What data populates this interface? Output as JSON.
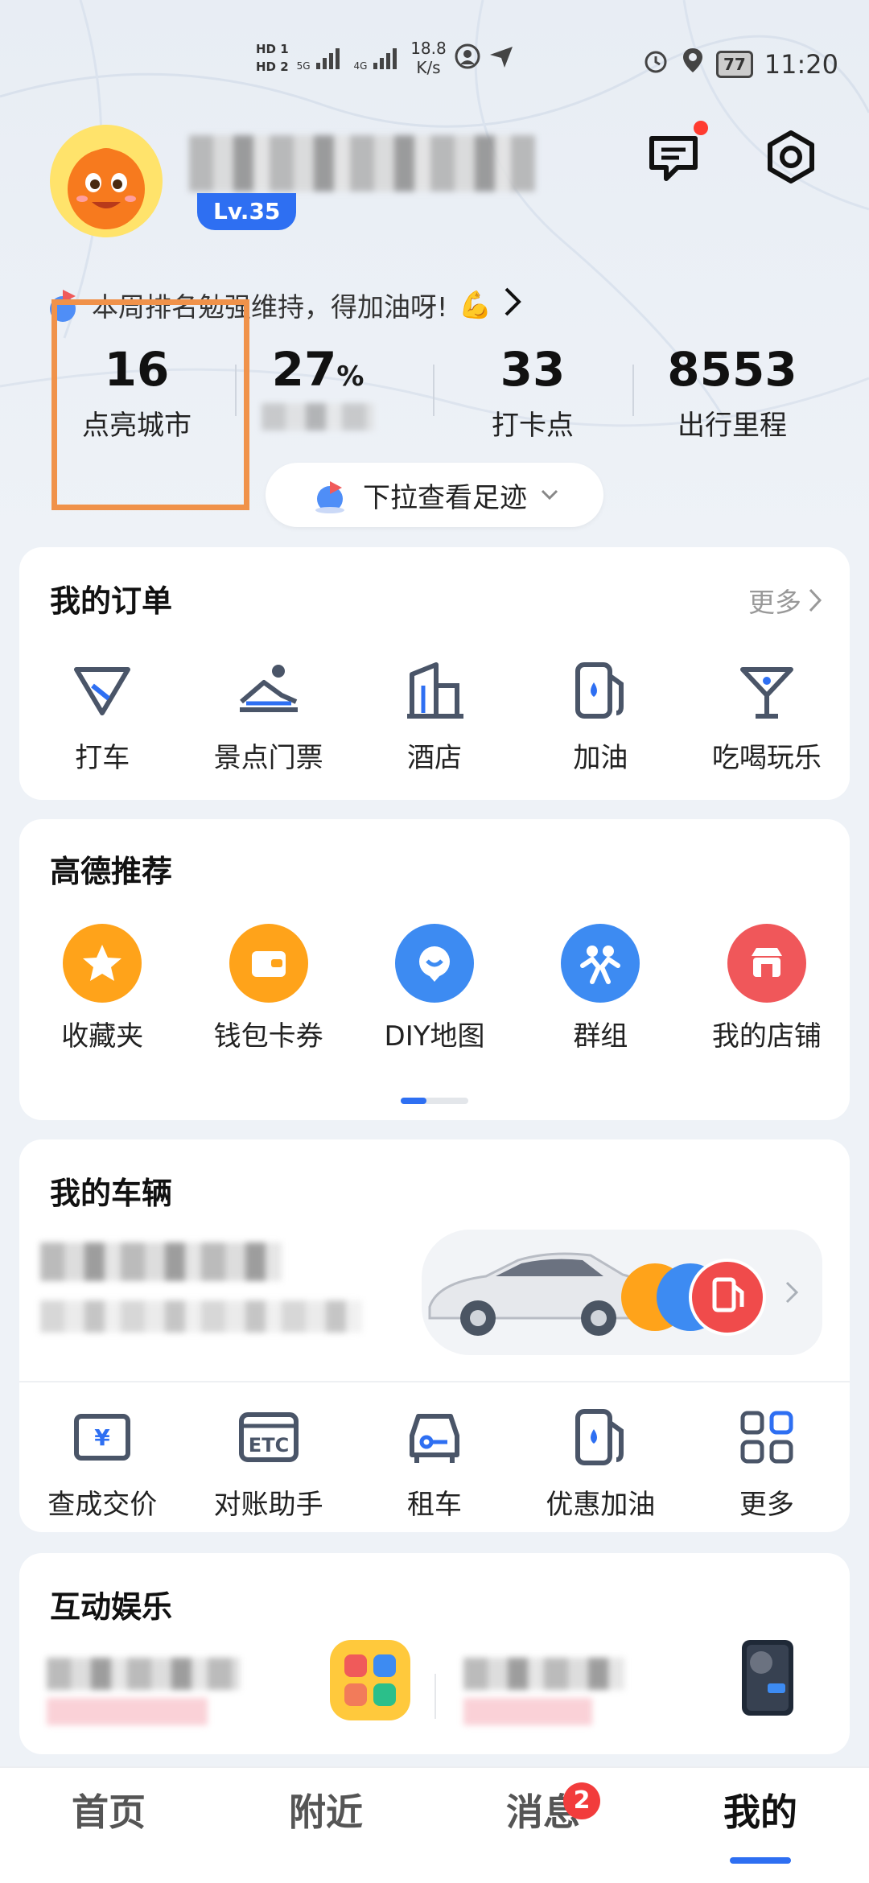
{
  "status_bar": {
    "hd1": "HD 1",
    "hd2": "HD 2",
    "net1": "5G",
    "net2": "4G",
    "speed_value": "18.8",
    "speed_unit": "K/s",
    "battery": "77",
    "time": "11:20"
  },
  "profile": {
    "level": "Lv.35"
  },
  "rank_banner": {
    "text": "本周排名勉强维持，得加油呀!",
    "emoji": "💪"
  },
  "stats": [
    {
      "value": "16",
      "unit": "",
      "label": "点亮城市"
    },
    {
      "value": "27",
      "unit": "%",
      "label": ""
    },
    {
      "value": "33",
      "unit": "",
      "label": "打卡点"
    },
    {
      "value": "8553",
      "unit": "",
      "label": "出行里程"
    }
  ],
  "footprint": {
    "label": "下拉查看足迹"
  },
  "orders": {
    "title": "我的订单",
    "more": "更多",
    "items": [
      {
        "label": "打车",
        "icon": "taxi-icon"
      },
      {
        "label": "景点门票",
        "icon": "scenic-icon"
      },
      {
        "label": "酒店",
        "icon": "hotel-icon"
      },
      {
        "label": "加油",
        "icon": "fuel-icon"
      },
      {
        "label": "吃喝玩乐",
        "icon": "cocktail-icon"
      }
    ]
  },
  "recommend": {
    "title": "高德推荐",
    "items": [
      {
        "label": "收藏夹",
        "icon": "star-icon",
        "color": "#ffa31a"
      },
      {
        "label": "钱包卡券",
        "icon": "wallet-icon",
        "color": "#ffa31a"
      },
      {
        "label": "DIY地图",
        "icon": "diy-map-icon",
        "color": "#3d8bf2"
      },
      {
        "label": "群组",
        "icon": "group-icon",
        "color": "#3d8bf2"
      },
      {
        "label": "我的店铺",
        "icon": "shop-icon",
        "color": "#f0575a"
      }
    ]
  },
  "vehicles": {
    "title": "我的车辆",
    "items": [
      {
        "label": "查成交价",
        "icon": "price-icon"
      },
      {
        "label": "对账助手",
        "icon": "etc-icon"
      },
      {
        "label": "租车",
        "icon": "rental-car-icon"
      },
      {
        "label": "优惠加油",
        "icon": "fuel-discount-icon"
      },
      {
        "label": "更多",
        "icon": "grid-more-icon"
      }
    ],
    "etc_text": "ETC"
  },
  "entertainment": {
    "title": "互动娱乐"
  },
  "bottom_nav": {
    "items": [
      {
        "label": "首页"
      },
      {
        "label": "附近"
      },
      {
        "label": "消息",
        "badge": "2"
      },
      {
        "label": "我的"
      }
    ]
  },
  "colors": {
    "accent": "#2e6ff2",
    "highlight": "#f0924a",
    "badge": "#f23c3c"
  }
}
